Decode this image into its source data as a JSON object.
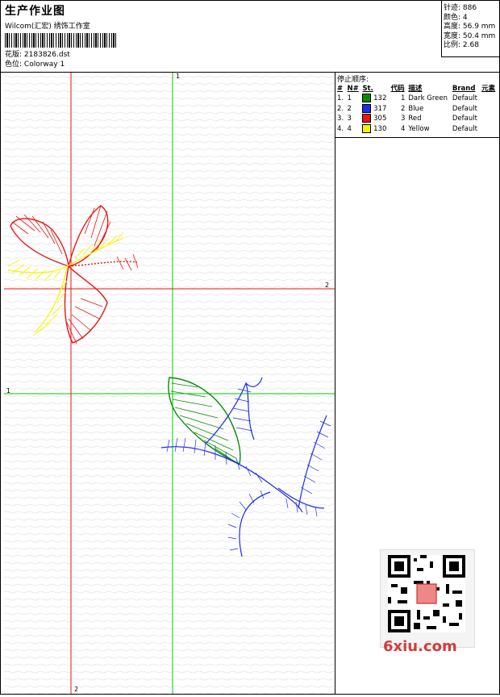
{
  "header": {
    "title": "生产作业图",
    "company": "Wilcom(汇宏) 绣饰工作室",
    "design_label": "花版:",
    "design_value": "2183826.dst",
    "colorway_label": "色位:",
    "colorway_value": "Colorway 1"
  },
  "stats": {
    "stitches": "针迹: 886",
    "colors": "颜色: 4",
    "height": "高度: 56.9 mm",
    "width": "宽度: 50.4 mm",
    "scale": "比例: 2.68"
  },
  "stop_sequence": {
    "label": "停止顺序:",
    "headers": [
      "#",
      "N#",
      "St.",
      "代码",
      "描述",
      "Brand",
      "元素"
    ],
    "rows": [
      {
        "idx": "1.",
        "n": "1",
        "color": "#0a8a0a",
        "st": "132",
        "code": "1",
        "desc": "Dark Green",
        "brand": "Default"
      },
      {
        "idx": "2.",
        "n": "2",
        "color": "#1e2de6",
        "st": "317",
        "code": "2",
        "desc": "Blue",
        "brand": "Default"
      },
      {
        "idx": "3.",
        "n": "3",
        "color": "#e61414",
        "st": "305",
        "code": "3",
        "desc": "Red",
        "brand": "Default"
      },
      {
        "idx": "4.",
        "n": "4",
        "color": "#f5f500",
        "st": "130",
        "code": "4",
        "desc": "Yellow",
        "brand": "Default"
      }
    ]
  },
  "guides": {
    "green_v": "1",
    "green_h": "1",
    "red_v": "2",
    "red_h": "2"
  },
  "watermark": "6xiu.com",
  "colors": {
    "green": "#00c800",
    "red": "#e61414",
    "blue": "#1e2de6",
    "yellow": "#f5f500",
    "dark_green": "#0a8a0a"
  }
}
